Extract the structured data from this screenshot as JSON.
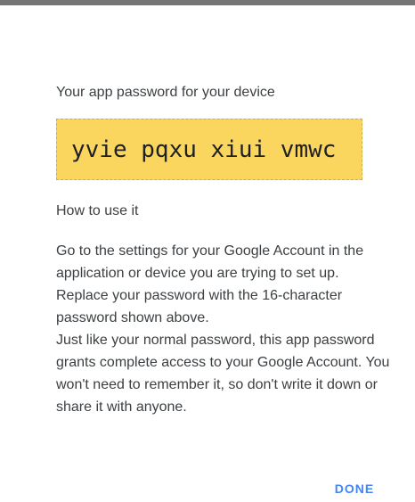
{
  "dialog": {
    "heading": "Your app password for your device",
    "password": "yvie pqxu xiui vmwc",
    "subheading": "How to use it",
    "paragraphs": [
      "Go to the settings for your Google Account in the application or device you are trying to set up. Replace your password with the 16-character password shown above.",
      "Just like your normal password, this app password grants complete access to your Google Account. You won't need to remember it, so don't write it down or share it with anyone."
    ],
    "done_label": "DONE"
  },
  "colors": {
    "password_background": "#fad65e",
    "text": "#3c4043",
    "accent": "#4285f4",
    "top_bar": "#757575"
  }
}
